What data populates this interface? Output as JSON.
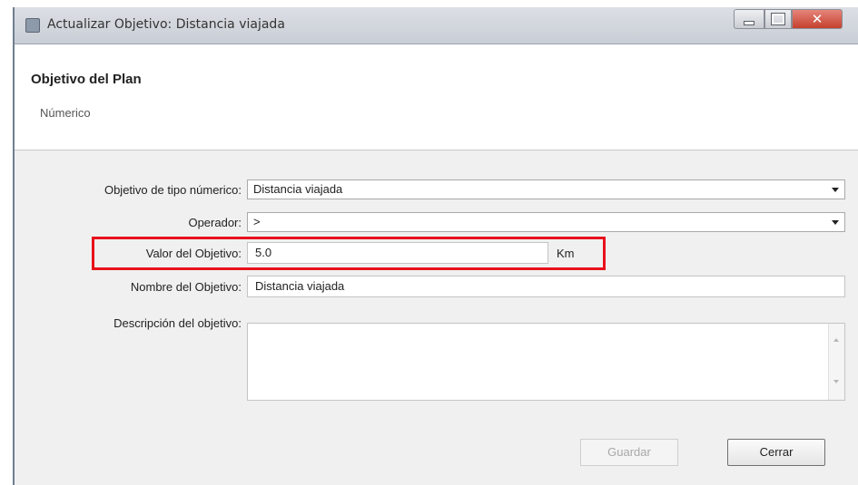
{
  "window": {
    "title": "Actualizar Objetivo: Distancia viajada",
    "icon": "app-icon",
    "controls": {
      "minimize": "minimize-icon",
      "maximize": "maximize-icon",
      "close": "close-icon"
    },
    "close_glyph": "✕"
  },
  "header": {
    "title": "Objetivo del Plan",
    "subtitle": "Númerico"
  },
  "form": {
    "numeric_objective": {
      "label": "Objetivo de tipo númerico:",
      "value": "Distancia viajada"
    },
    "operator": {
      "label": "Operador:",
      "value": ">"
    },
    "objective_value": {
      "label": "Valor del Objetivo:",
      "value": "5.0",
      "unit": "Km"
    },
    "objective_name": {
      "label": "Nombre del Objetivo:",
      "value": "Distancia viajada"
    },
    "objective_description": {
      "label": "Descripción del objetivo:",
      "value": ""
    }
  },
  "buttons": {
    "save": "Guardar",
    "close": "Cerrar"
  },
  "colors": {
    "highlight": "#e8111b",
    "dialog_bg": "#f0f0f0",
    "close_button": "#c5402e"
  }
}
